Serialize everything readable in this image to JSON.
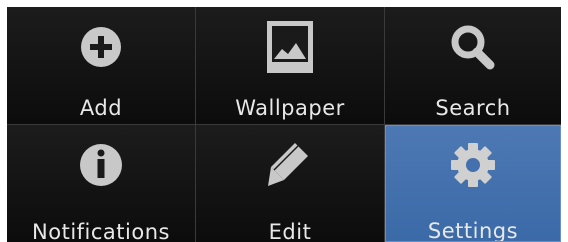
{
  "menu": {
    "items": [
      {
        "label": "Add",
        "icon": "add-icon"
      },
      {
        "label": "Wallpaper",
        "icon": "wallpaper-icon"
      },
      {
        "label": "Search",
        "icon": "search-icon"
      },
      {
        "label": "Notifications",
        "icon": "info-icon"
      },
      {
        "label": "Edit",
        "icon": "edit-pencil-icon"
      },
      {
        "label": "Settings",
        "icon": "gear-icon",
        "selected": true
      }
    ]
  },
  "colors": {
    "background": "#121212",
    "icon": "#c8c8c8",
    "label": "#e8e8e8",
    "selected": "#4470ad",
    "divider": "#3a3a3a"
  }
}
